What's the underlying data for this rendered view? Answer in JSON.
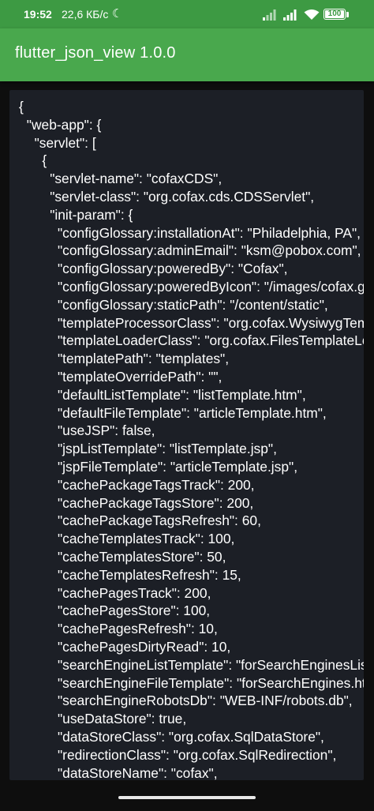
{
  "status_bar": {
    "time": "19:52",
    "speed": "22,6 КБ/с",
    "dnd_icon": "moon-icon",
    "battery": "100",
    "color": "#3d9a43"
  },
  "app_bar": {
    "title": "flutter_json_view 1.0.0",
    "color": "#49a84d"
  },
  "json_view": {
    "background": "#1c1f26",
    "lines": [
      {
        "indent": 0,
        "text": "{"
      },
      {
        "indent": 1,
        "text": "\"web-app\": {"
      },
      {
        "indent": 2,
        "text": "\"servlet\": ["
      },
      {
        "indent": 3,
        "text": "{"
      },
      {
        "indent": 4,
        "text": "\"servlet-name\": \"cofaxCDS\","
      },
      {
        "indent": 4,
        "text": "\"servlet-class\": \"org.cofax.cds.CDSServlet\","
      },
      {
        "indent": 4,
        "text": "\"init-param\": {"
      },
      {
        "indent": 5,
        "text": "\"configGlossary:installationAt\": \"Philadelphia, PA\","
      },
      {
        "indent": 5,
        "text": "\"configGlossary:adminEmail\": \"ksm@pobox.com\","
      },
      {
        "indent": 5,
        "text": "\"configGlossary:poweredBy\": \"Cofax\","
      },
      {
        "indent": 5,
        "text": "\"configGlossary:poweredByIcon\": \"/images/cofax.gif\","
      },
      {
        "indent": 5,
        "text": "\"configGlossary:staticPath\": \"/content/static\","
      },
      {
        "indent": 5,
        "text": "\"templateProcessorClass\": \"org.cofax.WysiwygTemplate\","
      },
      {
        "indent": 5,
        "text": "\"templateLoaderClass\": \"org.cofax.FilesTemplateLoader\","
      },
      {
        "indent": 5,
        "text": "\"templatePath\": \"templates\","
      },
      {
        "indent": 5,
        "text": "\"templateOverridePath\": \"\","
      },
      {
        "indent": 5,
        "text": "\"defaultListTemplate\": \"listTemplate.htm\","
      },
      {
        "indent": 5,
        "text": "\"defaultFileTemplate\": \"articleTemplate.htm\","
      },
      {
        "indent": 5,
        "text": "\"useJSP\": false,"
      },
      {
        "indent": 5,
        "text": "\"jspListTemplate\": \"listTemplate.jsp\","
      },
      {
        "indent": 5,
        "text": "\"jspFileTemplate\": \"articleTemplate.jsp\","
      },
      {
        "indent": 5,
        "text": "\"cachePackageTagsTrack\": 200,"
      },
      {
        "indent": 5,
        "text": "\"cachePackageTagsStore\": 200,"
      },
      {
        "indent": 5,
        "text": "\"cachePackageTagsRefresh\": 60,"
      },
      {
        "indent": 5,
        "text": "\"cacheTemplatesTrack\": 100,"
      },
      {
        "indent": 5,
        "text": "\"cacheTemplatesStore\": 50,"
      },
      {
        "indent": 5,
        "text": "\"cacheTemplatesRefresh\": 15,"
      },
      {
        "indent": 5,
        "text": "\"cachePagesTrack\": 200,"
      },
      {
        "indent": 5,
        "text": "\"cachePagesStore\": 100,"
      },
      {
        "indent": 5,
        "text": "\"cachePagesRefresh\": 10,"
      },
      {
        "indent": 5,
        "text": "\"cachePagesDirtyRead\": 10,"
      },
      {
        "indent": 5,
        "text": "\"searchEngineListTemplate\": \"forSearchEnginesList.htm\","
      },
      {
        "indent": 5,
        "text": "\"searchEngineFileTemplate\": \"forSearchEngines.htm\","
      },
      {
        "indent": 5,
        "text": "\"searchEngineRobotsDb\": \"WEB-INF/robots.db\","
      },
      {
        "indent": 5,
        "text": "\"useDataStore\": true,"
      },
      {
        "indent": 5,
        "text": "\"dataStoreClass\": \"org.cofax.SqlDataStore\","
      },
      {
        "indent": 5,
        "text": "\"redirectionClass\": \"org.cofax.SqlRedirection\","
      },
      {
        "indent": 5,
        "text": "\"dataStoreName\": \"cofax\","
      }
    ]
  }
}
